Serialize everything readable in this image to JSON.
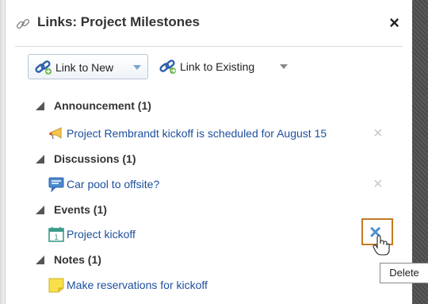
{
  "dialog": {
    "title": "Links: Project Milestones",
    "close_glyph": "×"
  },
  "toolbar": {
    "link_new_label": "Link to New",
    "link_existing_label": "Link to Existing"
  },
  "sections": [
    {
      "label": "Announcement (1)",
      "item": {
        "text": "Project Rembrandt kickoff is scheduled for August 15",
        "icon": "megaphone-icon"
      }
    },
    {
      "label": "Discussions (1)",
      "item": {
        "text": "Car pool to offsite?",
        "icon": "speech-bubble-icon"
      }
    },
    {
      "label": "Events (1)",
      "item": {
        "text": "Project kickoff",
        "icon": "calendar-icon",
        "calendar_day": "1"
      }
    },
    {
      "label": "Notes (1)",
      "item": {
        "text": "Make reservations for kickoff",
        "icon": "sticky-note-icon"
      }
    }
  ],
  "delete_glyph": "×",
  "tooltip": "Delete",
  "colors": {
    "link": "#1c4f9c",
    "highlight_border": "#c47a24",
    "delete_active": "#4a90d0"
  }
}
